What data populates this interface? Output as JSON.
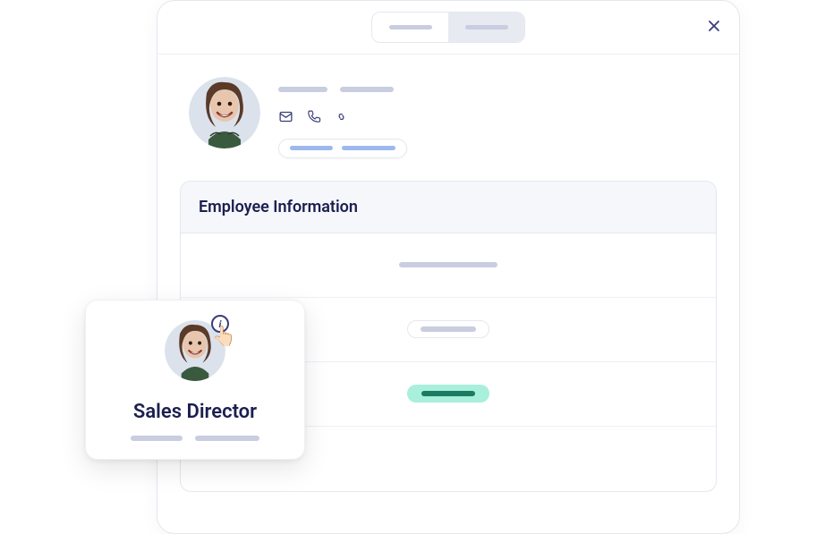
{
  "section_title": "Employee Information",
  "card_title": "Sales Director",
  "info_char": "i",
  "cursor_char": "👆🏻",
  "colors": {
    "brand_text": "#1b1f4f",
    "icon": "#3a3e78",
    "skeleton": "#c9cde0",
    "skeleton_blue": "#9db8ef",
    "green_bg": "#a8efdc",
    "green_fg": "#1b7a62"
  }
}
